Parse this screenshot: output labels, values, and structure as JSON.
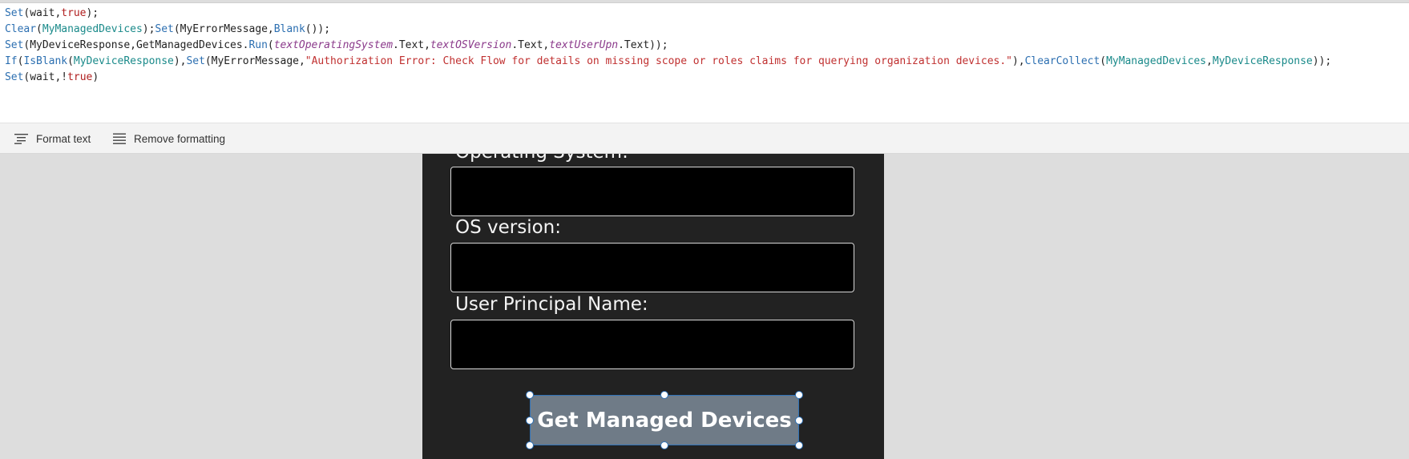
{
  "formula_bar": {
    "lines": [
      [
        {
          "t": "Set",
          "c": "fn"
        },
        {
          "t": "(wait,",
          "c": "tx"
        },
        {
          "t": "true",
          "c": "bo"
        },
        {
          "t": ");",
          "c": "tx"
        }
      ],
      [
        {
          "t": "Clear",
          "c": "fn"
        },
        {
          "t": "(",
          "c": "tx"
        },
        {
          "t": "MyManagedDevices",
          "c": "vr"
        },
        {
          "t": ");",
          "c": "tx"
        },
        {
          "t": "Set",
          "c": "fn"
        },
        {
          "t": "(MyErrorMessage,",
          "c": "tx"
        },
        {
          "t": "Blank",
          "c": "fn"
        },
        {
          "t": "());",
          "c": "tx"
        }
      ],
      [
        {
          "t": "Set",
          "c": "fn"
        },
        {
          "t": "(MyDeviceResponse,GetManagedDevices.",
          "c": "tx"
        },
        {
          "t": "Run",
          "c": "fn"
        },
        {
          "t": "(",
          "c": "tx"
        },
        {
          "t": "textOperatingSystem",
          "c": "it"
        },
        {
          "t": ".Text,",
          "c": "tx"
        },
        {
          "t": "textOSVersion",
          "c": "it"
        },
        {
          "t": ".Text,",
          "c": "tx"
        },
        {
          "t": "textUserUpn",
          "c": "it"
        },
        {
          "t": ".Text));",
          "c": "tx"
        }
      ],
      [
        {
          "t": "If",
          "c": "fn"
        },
        {
          "t": "(",
          "c": "tx"
        },
        {
          "t": "IsBlank",
          "c": "fn"
        },
        {
          "t": "(",
          "c": "tx"
        },
        {
          "t": "MyDeviceResponse",
          "c": "vr"
        },
        {
          "t": "),",
          "c": "tx"
        },
        {
          "t": "Set",
          "c": "fn"
        },
        {
          "t": "(MyErrorMessage,",
          "c": "tx"
        },
        {
          "t": "\"Authorization Error: Check Flow for details on missing scope or roles claims for querying organization devices.\"",
          "c": "str"
        },
        {
          "t": "),",
          "c": "tx"
        },
        {
          "t": "ClearCollect",
          "c": "fn"
        },
        {
          "t": "(",
          "c": "tx"
        },
        {
          "t": "MyManagedDevices",
          "c": "vr"
        },
        {
          "t": ",",
          "c": "tx"
        },
        {
          "t": "MyDeviceResponse",
          "c": "vr"
        },
        {
          "t": "));",
          "c": "tx"
        }
      ],
      [
        {
          "t": "Set",
          "c": "fn"
        },
        {
          "t": "(wait,!",
          "c": "tx"
        },
        {
          "t": "true",
          "c": "bo"
        },
        {
          "t": ")",
          "c": "tx"
        }
      ]
    ]
  },
  "toolbar": {
    "format_text_label": "Format text",
    "remove_formatting_label": "Remove formatting"
  },
  "form": {
    "os_label": "Operating System:",
    "os_version_label": "OS version:",
    "upn_label": "User Principal Name:",
    "submit_label": "Get Managed Devices"
  },
  "colors": {
    "canvas_bg": "#dddddd",
    "screen_bg": "#222222",
    "button_bg": "#6f7b87",
    "selection": "#2f72b8"
  },
  "icons": [
    "format-text-icon",
    "remove-formatting-icon"
  ]
}
